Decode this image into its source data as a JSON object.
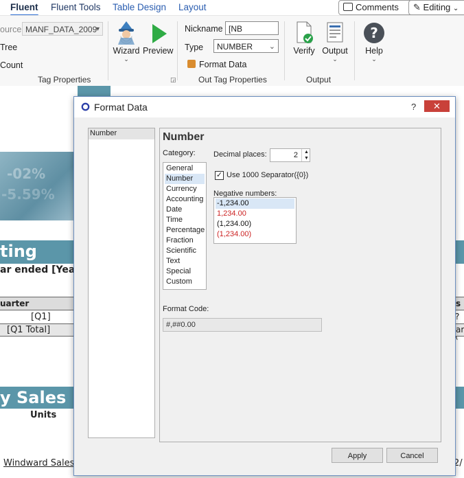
{
  "ribbon": {
    "tabs": [
      {
        "label": "Fluent",
        "active": true
      },
      {
        "label": "Fluent Tools"
      },
      {
        "label": "Table Design"
      },
      {
        "label": "Layout"
      }
    ],
    "comments_label": "Comments",
    "editing_label": "Editing",
    "source_label": "ource",
    "source_value": "MANF_DATA_2009",
    "tree_label": "Tree",
    "count_label": "Count",
    "wizard_label": "Wizard",
    "preview_label": "Preview",
    "nickname_label": "Nickname",
    "nickname_value": "[NB Variance]",
    "type_label": "Type",
    "type_value": "NUMBER",
    "format_data_label": "Format Data",
    "verify_label": "Verify",
    "output_label": "Output",
    "help_label": "Help",
    "groups": {
      "tag_properties": "Tag Properties",
      "out_tag_properties": "Out Tag Properties",
      "output": "Output"
    }
  },
  "document": {
    "heading1": "ting Over",
    "subtitle": "ar ended [Year",
    "table_header_left": "uarter",
    "table_header_right": "s",
    "row1_left": "[Q1]",
    "row1_right": "?+(",
    "row2_left": "[Q1 Total]",
    "row2_right": "ara",
    "heading2": "y Sales Pr",
    "units": "Units",
    "footer_left": "Windward Sales",
    "footer_right": "2/"
  },
  "dialog": {
    "title": "Format Data",
    "help": "?",
    "close": "✕",
    "left_list": [
      "Number"
    ],
    "section_title": "Number",
    "category_label": "Category:",
    "categories": [
      "General",
      "Number",
      "Currency",
      "Accounting",
      "Date",
      "Time",
      "Percentage",
      "Fraction",
      "Scientific",
      "Text",
      "Special",
      "Custom"
    ],
    "selected_category": "Number",
    "decimal_label": "Decimal places:",
    "decimal_value": "2",
    "separator_label": "Use 1000 Separator({0})",
    "separator_checked": true,
    "negative_label": "Negative numbers:",
    "negatives": [
      "-1,234.00",
      "1,234.00",
      "(1,234.00)",
      "(1,234.00)"
    ],
    "format_code_label": "Format Code:",
    "format_code": "#,##0.00",
    "apply_label": "Apply",
    "cancel_label": "Cancel"
  },
  "colors": {
    "accent_blue": "#2b6bd1",
    "band": "#5b96a9",
    "negative_red": "#cc2222",
    "close_red": "#c9413a"
  }
}
